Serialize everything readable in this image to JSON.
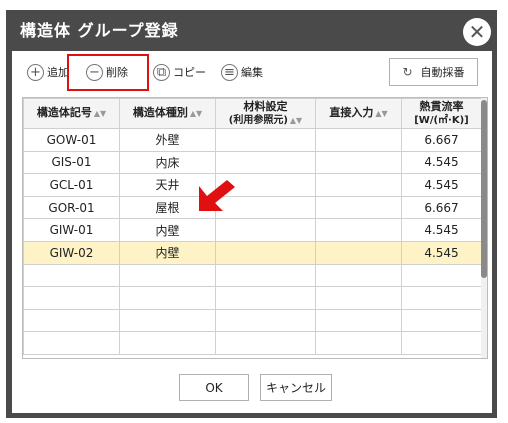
{
  "dialog": {
    "title": "構造体 グループ登録"
  },
  "toolbar": {
    "add_label": "追加",
    "delete_label": "削除",
    "copy_label": "コピー",
    "edit_label": "編集",
    "auto_label": "自動採番"
  },
  "table": {
    "headers": {
      "code": "構造体記号",
      "type": "構造体種別",
      "material_line1": "材料設定",
      "material_line2": "(利用参照元)",
      "direct": "直接入力",
      "heat_line1": "熱貫流率",
      "heat_line2": "[W/(㎡·K)]"
    },
    "rows": [
      {
        "code": "GOW-01",
        "type": "外壁",
        "material": "",
        "direct": "",
        "heat": "6.667"
      },
      {
        "code": "GIS-01",
        "type": "内床",
        "material": "",
        "direct": "",
        "heat": "4.545"
      },
      {
        "code": "GCL-01",
        "type": "天井",
        "material": "",
        "direct": "",
        "heat": "4.545"
      },
      {
        "code": "GOR-01",
        "type": "屋根",
        "material": "",
        "direct": "",
        "heat": "6.667"
      },
      {
        "code": "GIW-01",
        "type": "内壁",
        "material": "",
        "direct": "",
        "heat": "4.545"
      },
      {
        "code": "GIW-02",
        "type": "内壁",
        "material": "",
        "direct": "",
        "heat": "4.545"
      }
    ]
  },
  "footer": {
    "ok_label": "OK",
    "cancel_label": "キャンセル"
  },
  "colors": {
    "highlight": "#e01010",
    "selected_row": "#fdf3c6",
    "title_bar": "#4a4a4a"
  }
}
